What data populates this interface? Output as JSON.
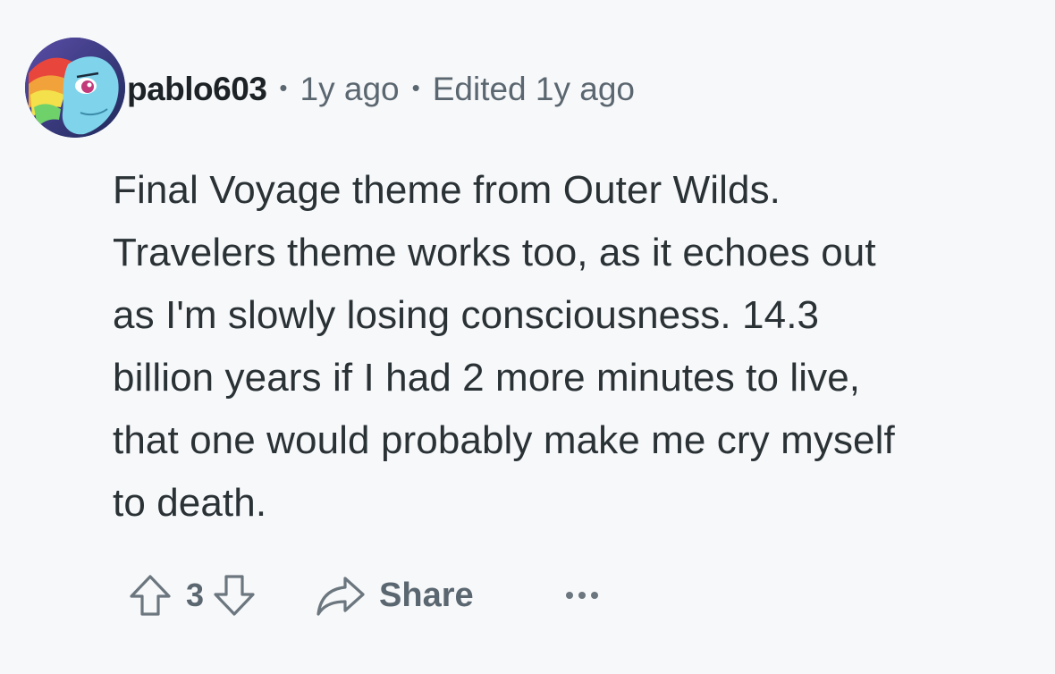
{
  "comment": {
    "author": "pablo603",
    "posted": "1y ago",
    "edited": "Edited 1y ago",
    "separator": "•",
    "paragraph_lines": [
      "Final Voyage theme from Outer Wilds.",
      "Travelers theme works too, as it echoes out",
      "as I'm slowly losing consciousness. 14.3",
      "billion years if I had 2 more minutes to live,",
      "that one would probably make me cry myself",
      "to death."
    ],
    "score": "3",
    "share_label": "Share"
  },
  "icons": {
    "upvote": "upvote-arrow-icon",
    "downvote": "downvote-arrow-icon",
    "share": "share-arrow-icon",
    "more": "more-options-icon"
  },
  "colors": {
    "background": "#f7f8fa",
    "text": "#2a3236",
    "muted": "#5b6770"
  }
}
